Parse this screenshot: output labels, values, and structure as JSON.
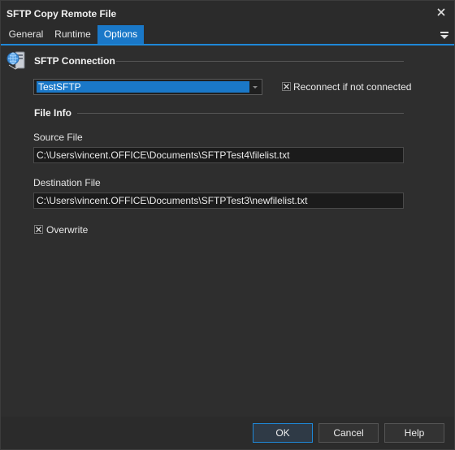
{
  "window": {
    "title": "SFTP Copy Remote File"
  },
  "tabs": [
    {
      "label": "General"
    },
    {
      "label": "Runtime"
    },
    {
      "label": "Options",
      "active": true
    }
  ],
  "sections": {
    "connection": {
      "title": "SFTP Connection",
      "selected_connection": "TestSFTP",
      "reconnect": {
        "label": "Reconnect if not connected",
        "checked": true
      }
    },
    "file_info": {
      "title": "File Info",
      "source_label": "Source File",
      "source_value": "C:\\Users\\vincent.OFFICE\\Documents\\SFTPTest4\\filelist.txt",
      "destination_label": "Destination File",
      "destination_value": "C:\\Users\\vincent.OFFICE\\Documents\\SFTPTest3\\newfilelist.txt",
      "overwrite": {
        "label": "Overwrite",
        "checked": true
      }
    }
  },
  "buttons": {
    "ok": "OK",
    "cancel": "Cancel",
    "help": "Help"
  },
  "colors": {
    "accent": "#1a78c8",
    "background": "#2b2b2b",
    "field": "#1b1b1b"
  }
}
